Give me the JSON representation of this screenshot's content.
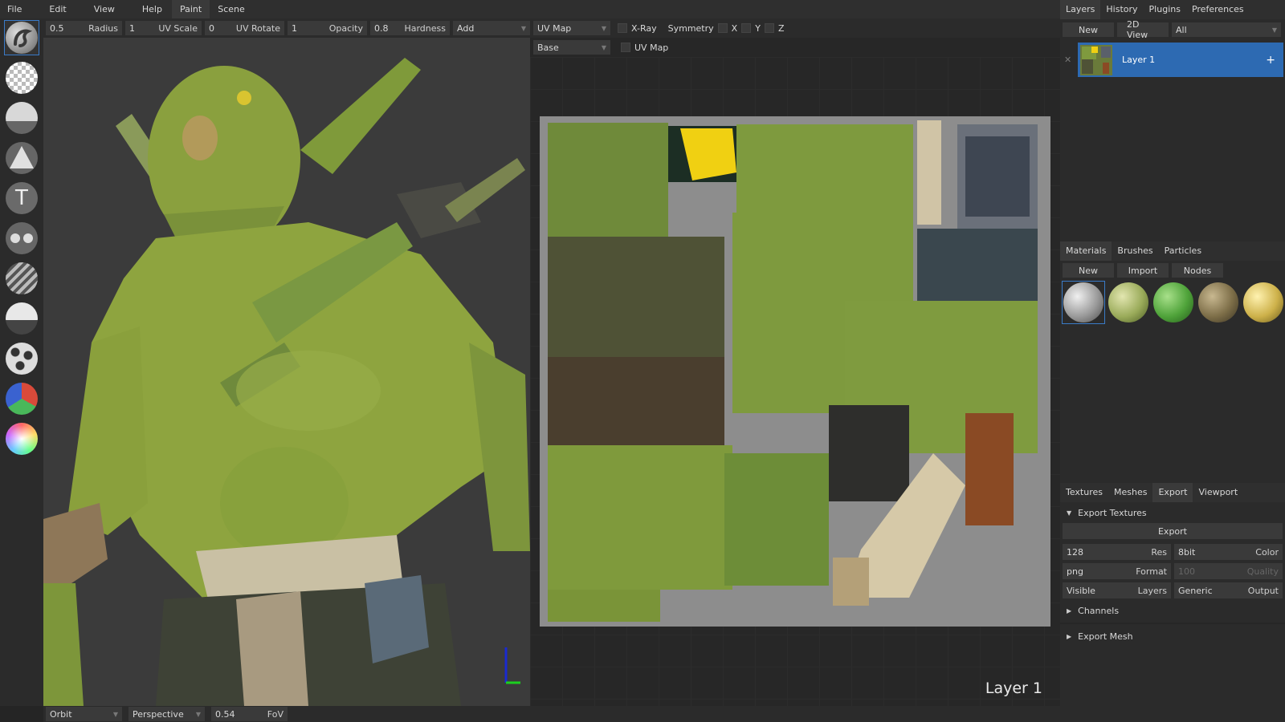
{
  "menu": [
    "File",
    "Edit",
    "View",
    "Help"
  ],
  "workspace_tabs": [
    {
      "label": "Paint",
      "active": true
    },
    {
      "label": "Scene",
      "active": false
    }
  ],
  "toolbar": {
    "radius": {
      "value": "0.5",
      "label": "Radius"
    },
    "uv_scale": {
      "value": "1",
      "label": "UV Scale"
    },
    "uv_rotate": {
      "value": "0",
      "label": "UV Rotate"
    },
    "opacity": {
      "value": "1",
      "label": "Opacity"
    },
    "hardness": {
      "value": "0.8",
      "label": "Hardness"
    },
    "blend_mode": "Add",
    "projection": "UV Map",
    "xray_label": "X-Ray",
    "symmetry_label": "Symmetry",
    "sym_x": "X",
    "sym_y": "Y",
    "sym_z": "Z"
  },
  "tools": [
    "brush-icon",
    "eraser-icon",
    "fill-icon",
    "decal-icon",
    "text-icon",
    "clone-icon",
    "blur-icon",
    "smudge-icon",
    "particle-icon",
    "colorid-icon",
    "picker-icon"
  ],
  "view2d": {
    "layer_select": "Base",
    "mode_select": "UV Map",
    "overlay_label": "Layer 1"
  },
  "statusbar": {
    "camera_mode": "Orbit",
    "projection": "Perspective",
    "fov_value": "0.54",
    "fov_label": "FoV"
  },
  "right_top_tabs": [
    {
      "label": "Layers",
      "active": true
    },
    {
      "label": "History",
      "active": false
    },
    {
      "label": "Plugins",
      "active": false
    },
    {
      "label": "Preferences",
      "active": false
    }
  ],
  "layers_toolbar": {
    "new_label": "New",
    "view_label": "2D View",
    "filter": "All"
  },
  "layers": [
    {
      "name": "Layer 1",
      "add_icon": "+"
    }
  ],
  "materials_tabs": [
    {
      "label": "Materials",
      "active": true
    },
    {
      "label": "Brushes",
      "active": false
    },
    {
      "label": "Particles",
      "active": false
    }
  ],
  "materials_toolbar": {
    "new_label": "New",
    "import_label": "Import",
    "nodes_label": "Nodes"
  },
  "materials": [
    {
      "color": "#b8b8b8"
    },
    {
      "color": "#9aab5a"
    },
    {
      "color": "#4fa33a"
    },
    {
      "color": "#7d6e48"
    },
    {
      "color": "#cdb14a"
    }
  ],
  "bottom_tabs": [
    {
      "label": "Textures",
      "active": false
    },
    {
      "label": "Meshes",
      "active": false
    },
    {
      "label": "Export",
      "active": true
    },
    {
      "label": "Viewport",
      "active": false
    }
  ],
  "export": {
    "section_label": "Export Textures",
    "export_button": "Export",
    "res_value": "128",
    "res_label": "Res",
    "depth_value": "8bit",
    "depth_label": "Color",
    "format_value": "png",
    "format_label": "Format",
    "quality_value": "100",
    "quality_label": "Quality",
    "layers_value": "Visible",
    "layers_label": "Layers",
    "output_value": "Generic",
    "output_label": "Output",
    "channels_label": "Channels",
    "export_mesh_label": "Export Mesh"
  }
}
